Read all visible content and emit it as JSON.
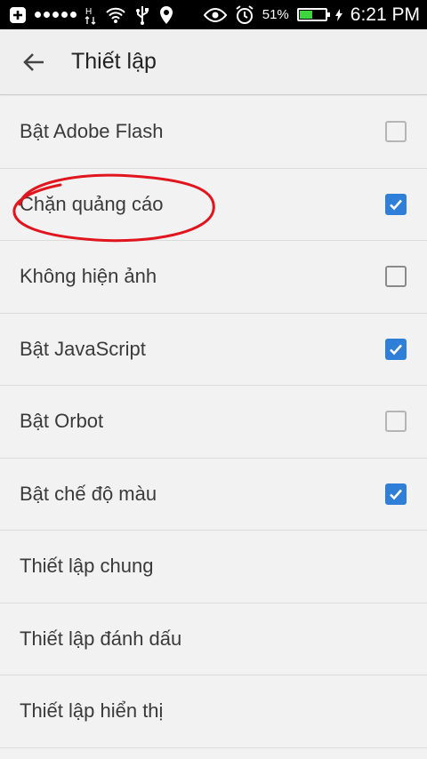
{
  "status_bar": {
    "battery_percent": "51%",
    "battery_level": 0.51,
    "time": "6:21 PM",
    "icons": [
      "plus-box-icon",
      "signal-dots-icon",
      "h-network-icon",
      "wifi-icon",
      "usb-icon",
      "location-icon",
      "eye-icon",
      "alarm-icon",
      "battery-icon"
    ]
  },
  "app_bar": {
    "title": "Thiết lập",
    "back_icon": "arrow-back-icon"
  },
  "settings": [
    {
      "label": "Bật Adobe Flash",
      "checkbox": true,
      "checked": false
    },
    {
      "label": "Chặn quảng cáo",
      "checkbox": true,
      "checked": true
    },
    {
      "label": "Không hiện ảnh",
      "checkbox": true,
      "checked": false
    },
    {
      "label": "Bật JavaScript",
      "checkbox": true,
      "checked": true
    },
    {
      "label": "Bật Orbot",
      "checkbox": true,
      "checked": false
    },
    {
      "label": "Bật chế độ màu",
      "checkbox": true,
      "checked": true
    },
    {
      "label": "Thiết lập chung",
      "checkbox": false
    },
    {
      "label": "Thiết lập đánh dấu",
      "checkbox": false
    },
    {
      "label": "Thiết lập hiển thị",
      "checkbox": false
    }
  ],
  "colors": {
    "checkbox_checked": "#2f7fd8",
    "annotation": "#e0151d",
    "battery_fill": "#3dd63d"
  }
}
